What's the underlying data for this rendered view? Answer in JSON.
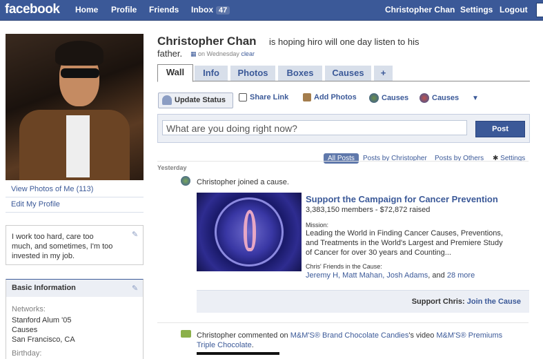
{
  "topbar": {
    "logo": "facebook",
    "nav": [
      "Home",
      "Profile",
      "Friends"
    ],
    "inbox_label": "Inbox",
    "inbox_count": "47",
    "user_name": "Christopher Chan",
    "settings": "Settings",
    "logout": "Logout"
  },
  "sidebar": {
    "view_photos": "View Photos of Me (113)",
    "edit_profile": "Edit My Profile",
    "about": "I work too hard, care too much, and sometimes, I'm too invested in my job.",
    "basic_info_title": "Basic Information",
    "networks_label": "Networks:",
    "networks": [
      "Stanford Alum '05",
      "Causes",
      "San Francisco, CA"
    ],
    "birthday_label": "Birthday:"
  },
  "profile": {
    "name": "Christopher Chan",
    "status_line1": "is hoping hiro will one day listen to his",
    "status_line2": "father.",
    "status_time": "on Wednesday",
    "status_clear": "clear"
  },
  "tabs": [
    "Wall",
    "Info",
    "Photos",
    "Boxes",
    "Causes",
    "+"
  ],
  "actions": {
    "update_status": "Update Status",
    "share_link": "Share Link",
    "add_photos": "Add Photos",
    "causes1": "Causes",
    "causes2": "Causes"
  },
  "composer": {
    "placeholder": "What are you doing right now?",
    "post": "Post"
  },
  "filters": {
    "all": "All Posts",
    "by_chris": "Posts by Christopher",
    "by_others": "Posts by Others",
    "settings": "Settings"
  },
  "feed": {
    "day_label": "Yesterday",
    "story1": "Christopher joined a cause.",
    "cause_title": "Support the Campaign for Cancer Prevention",
    "cause_stats": "3,383,150 members - $72,872 raised",
    "mission_label": "Mission:",
    "mission_lines": [
      "Leading the World in Finding Cancer Causes, Preventions,",
      "and Treatments in the World's Largest and Premiere Study",
      "of Cancer for over 30 years and Counting..."
    ],
    "friends_label": "Chris' Friends in the Cause:",
    "friends": "Jeremy H, Matt Mahan, Josh Adams",
    "friends_and": ", and",
    "friends_more": "28 more",
    "support_prefix": "Support Chris:",
    "support_link": "Join the Cause",
    "story2_prefix": "Christopher commented on",
    "story2_link1": "M&M'S® Brand Chocolate Candies",
    "story2_mid": "'s video",
    "story2_link2": "M&M'S® Premiums",
    "story2_link2b": "Triple Chocolate",
    "story2_end": "."
  },
  "colors": {
    "brand_blue": "#3b5998",
    "light_blue": "#d8dfea",
    "panel_bg": "#eceff5"
  }
}
